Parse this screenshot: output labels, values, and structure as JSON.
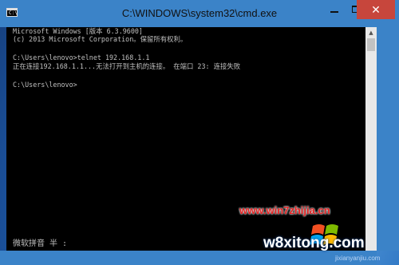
{
  "window": {
    "icon_text": "C:\\",
    "title": "C:\\WINDOWS\\system32\\cmd.exe",
    "minimize_label": "",
    "maximize_label": "",
    "close_label": "✕"
  },
  "console": {
    "lines": [
      "Microsoft Windows [版本 6.3.9600]",
      "(c) 2013 Microsoft Corporation。保留所有权利。",
      "",
      "C:\\Users\\lenovo>telnet 192.168.1.1",
      "正在连接192.168.1.1...无法打开到主机的连接。 在端口 23: 连接失败",
      "",
      "C:\\Users\\lenovo>"
    ],
    "ime_status": "微软拼音 半 :"
  },
  "watermarks": {
    "site1": "www.win7zhijia.cn",
    "site2": "w8xitong.com",
    "site3": "jixianyanjiu.com"
  },
  "colors": {
    "titlebar": "#3b83c8",
    "close_button": "#c7463c",
    "console_bg": "#000000",
    "console_text": "#c0c0c0",
    "watermark_red": "#e52222"
  }
}
